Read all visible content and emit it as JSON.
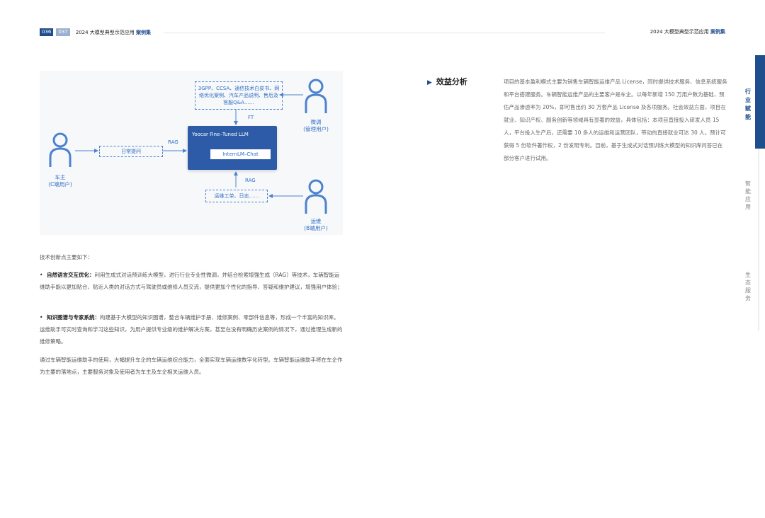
{
  "header": {
    "page_left": "036",
    "page_right": "037",
    "title_left": "2024 大模型典型示范应用",
    "title_left_accent": "案例集",
    "title_right": "2024 大模型典型示范应用",
    "title_right_accent": "案例集"
  },
  "diagram": {
    "colors": {
      "accent": "#2f6fc4",
      "box": "#2d5ba8"
    },
    "user_owner": {
      "name": "车主",
      "role": "(C端用户)"
    },
    "user_manager": {
      "name": "微调",
      "role": "(管理用户)"
    },
    "user_ops": {
      "name": "运维",
      "role": "(B端用户)"
    },
    "docs_box": "3GPP、CCSA、通信技术白皮书、网络优化案例、汽车产品说明、售后及客服Q&A……",
    "daily_box": "日常提问",
    "ops_box": "运维工单、日志……",
    "llm_title": "Yoocar Fine–Tuned LLM",
    "llm_inner": "InternLM–Chat",
    "label_ft": "FT",
    "label_rag_left": "RAG",
    "label_rag_bottom": "RAG"
  },
  "left_text": {
    "intro": "技术创新点主要如下：",
    "p1_bold": "自然语言交互优化：",
    "p1_text": "利用生成式对话预训练大模型，进行行业专业性微调，并结合检索增强生成（RAG）等技术，车辆智能运维助手能以更加贴合、贴近人类的对话方式与驾驶员或维修人员交流，提供更加个性化的指导、答疑和维护建议，增强用户体验；",
    "p2_bold": "知识图谱与专家系统：",
    "p2_text": "构建基于大模型的知识图谱，整合车辆维护手册、维修案例、零部件信息等，形成一个丰富的知识库。运维助手可实时查询和学习这些知识，为用户提供专业级的维护解决方案，甚至在没有明确历史案例的情况下，通过推理生成新的维修策略。",
    "p3": "通过车辆智能运维助手的使用，大幅提升车企的车辆运维综合能力，全面实现车辆运维数字化转型。车辆智能运维助手将在车企作为主要的落地点，主要服务对象及使用者为车主及车企相关运维人员。"
  },
  "right_section": {
    "heading": "效益分析",
    "text": "项目的基本盈利模式主要为销售车辆智能运维产品 License，同时提供技术服务、信息系统服务和平台搭建服务。车辆智能运维产品的主要客户是车企。以每年新增 150 万用户数为基础，预估产品渗透率为 20%，即可售出约 30 万套产品 License 及各项服务。社会效益方面，项目在就业、知识产权、服务创新等领域具有显著的效益，具体包括：本项目直接投入研发人员 15 人，平台投入生产后，还需要 10 多人的运维和运营团队，带动的直接就业可达 30 人。预计可获得 5 份软件著作权，2 份发明专利。目前，基于生成式对话预训练大模型的知识库问答已在部分客户进行试用。"
  },
  "side_nav": {
    "active": "行业赋能",
    "item2": "智能应用",
    "item3": "生态服务"
  }
}
